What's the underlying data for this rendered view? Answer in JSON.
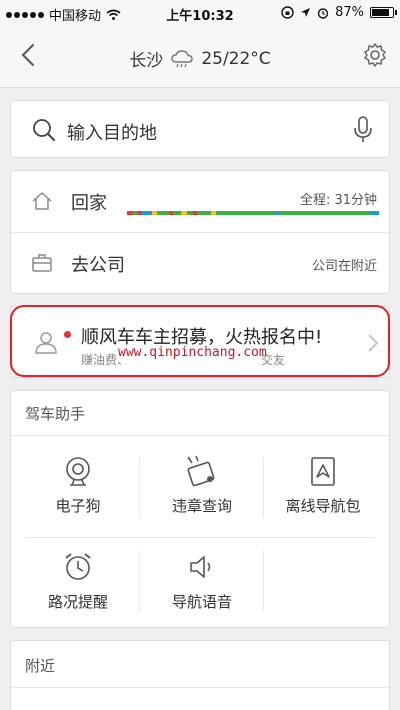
{
  "status_bar": {
    "carrier": "中国移动",
    "time": "上午10:32",
    "battery_percent": "87%",
    "battery_level": 0.87
  },
  "header": {
    "city": "长沙",
    "weather_icon": "cloud-rain-icon",
    "temperature": "25/22°C"
  },
  "search": {
    "placeholder": "输入目的地"
  },
  "routes": [
    {
      "label": "回家",
      "info": "全程: 31分钟",
      "icon": "home-icon"
    },
    {
      "label": "去公司",
      "info": "公司在附近",
      "icon": "briefcase-icon"
    }
  ],
  "traffic_colors": [
    "#e63b2e",
    "#f4c21b",
    "#3cb043",
    "#1f9ad6"
  ],
  "promo": {
    "title": "顺风车车主招募，火热报名中!",
    "subtitle": "赚油费、",
    "subtitle_tail": "交友",
    "watermark": "www.qinpinchang.com"
  },
  "assistant": {
    "title": "驾车助手",
    "tools": [
      {
        "label": "电子狗",
        "icon": "speed-camera-icon"
      },
      {
        "label": "违章查询",
        "icon": "violation-check-icon"
      },
      {
        "label": "离线导航包",
        "icon": "offline-map-icon"
      },
      {
        "label": "路况提醒",
        "icon": "alarm-clock-icon"
      },
      {
        "label": "导航语音",
        "icon": "speaker-icon"
      }
    ]
  },
  "nearby": {
    "title": "附近"
  },
  "colors": {
    "highlight_outline": "#e51e2a",
    "promo_dot": "#e0322e"
  }
}
